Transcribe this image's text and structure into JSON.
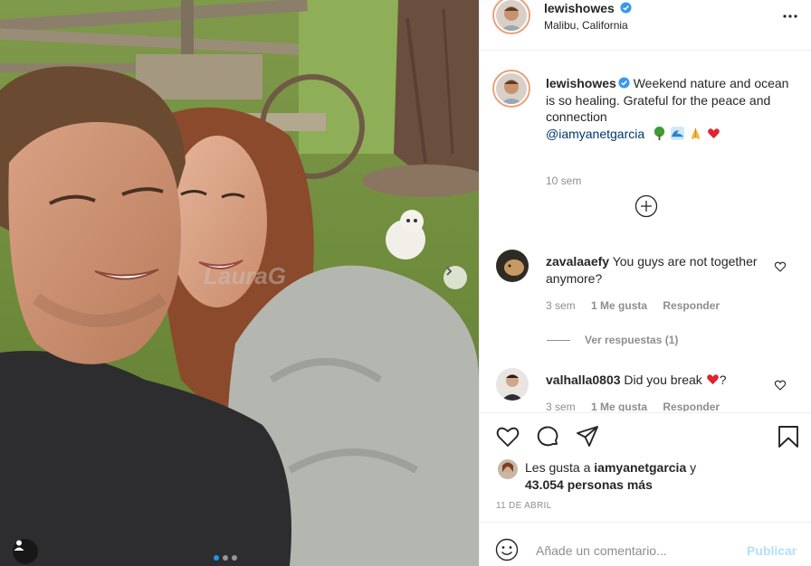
{
  "post": {
    "author": "lewishowes",
    "location": "Malibu, California",
    "caption_body": "Weekend nature and ocean is so healing. Grateful for the peace and connection",
    "caption_mention": "@iamyanetgarcia",
    "caption_emojis": [
      "deciduous-tree-emoji",
      "wave-emoji",
      "folded-hands-emoji",
      "red-heart-emoji"
    ],
    "time_ago": "10 sem",
    "date": "11 DE ABRIL",
    "carousel": {
      "slides": 3,
      "current": 1
    }
  },
  "comments": [
    {
      "user": "zavalaaefy",
      "text": "You guys are not together anymore?",
      "time": "3 sem",
      "likes": "1 Me gusta",
      "reply": "Responder",
      "view_replies": "Ver respuestas (1)"
    },
    {
      "user": "valhalla0803",
      "text_before": "Did you break",
      "text_after": "?",
      "time": "3 sem",
      "likes": "1 Me gusta",
      "reply": "Responder"
    }
  ],
  "likes": {
    "prefix": "Les gusta a",
    "user": "iamyanetgarcia",
    "connector": "y",
    "others": "43.054 personas más"
  },
  "add_comment": {
    "placeholder": "Añade un comentario...",
    "post_label": "Publicar"
  },
  "watermark": "LauraG",
  "colors": {
    "verified": "#3897f0",
    "mention": "#00376b",
    "post_disabled": "#b2dffc",
    "carousel_active_dot": "#1a9ae6"
  }
}
